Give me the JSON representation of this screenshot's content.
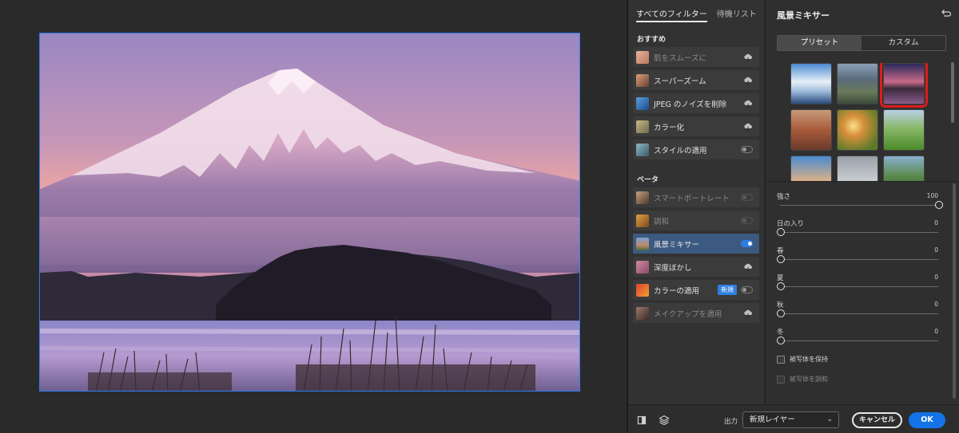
{
  "filter_panel": {
    "tabs": [
      "すべてのフィルター",
      "待機リスト"
    ],
    "featured_title": "おすすめ",
    "featured": [
      {
        "label": "肌をスムーズに",
        "state": "cloud",
        "disabled": true
      },
      {
        "label": "スーパーズーム",
        "state": "cloud",
        "disabled": false
      },
      {
        "label": "JPEG のノイズを削除",
        "state": "cloud",
        "disabled": false
      },
      {
        "label": "カラー化",
        "state": "cloud",
        "disabled": false
      },
      {
        "label": "スタイルの適用",
        "state": "toggle-off",
        "disabled": false
      }
    ],
    "beta_title": "ベータ",
    "beta": [
      {
        "label": "スマートポートレート",
        "state": "toggle-off",
        "disabled": true
      },
      {
        "label": "調和",
        "state": "toggle-off",
        "disabled": true
      },
      {
        "label": "風景ミキサー",
        "state": "toggle-on",
        "disabled": false,
        "selected": true
      },
      {
        "label": "深度ぼかし",
        "state": "cloud",
        "disabled": false
      },
      {
        "label": "カラーの適用",
        "state": "toggle-off",
        "disabled": false,
        "badge": "新規"
      },
      {
        "label": "メイクアップを適用",
        "state": "cloud",
        "disabled": true
      }
    ]
  },
  "settings": {
    "title": "風景ミキサー",
    "segments": [
      "プリセット",
      "カスタム"
    ],
    "active_segment": "プリセット",
    "presets_selected_index": 2,
    "sliders": [
      {
        "label": "強さ",
        "value": "100",
        "fraction": 1.0
      },
      {
        "label": "日の入り",
        "value": "0",
        "fraction": 0.0
      },
      {
        "label": "春",
        "value": "0",
        "fraction": 0.0
      },
      {
        "label": "夏",
        "value": "0",
        "fraction": 0.0
      },
      {
        "label": "秋",
        "value": "0",
        "fraction": 0.0
      },
      {
        "label": "冬",
        "value": "0",
        "fraction": 0.0
      }
    ],
    "checkboxes": [
      {
        "label": "被写体を保持",
        "checked": false,
        "disabled": false
      },
      {
        "label": "被写体を調和",
        "checked": false,
        "disabled": true
      }
    ]
  },
  "bottom": {
    "output_label": "出力",
    "output_value": "新規レイヤー",
    "cancel": "キャンセル",
    "ok": "OK"
  },
  "colors": {
    "accent": "#1473e6",
    "selection_outline": "#e01b1b",
    "canvas_border": "#2e7ef0"
  }
}
